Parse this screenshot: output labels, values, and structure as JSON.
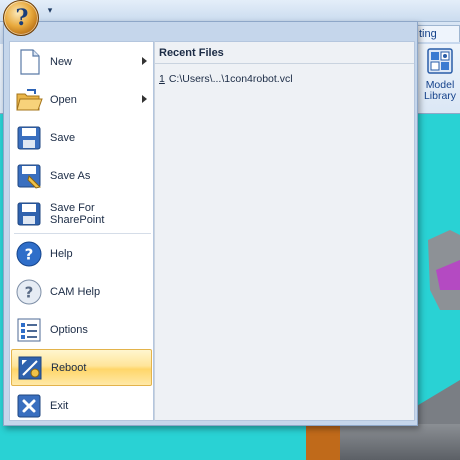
{
  "ribbon": {
    "tab_partial": "ting",
    "model_library": {
      "line1": "Model",
      "line2": "Library"
    }
  },
  "qat": {
    "customize_arrow": "▾"
  },
  "orb": {
    "glyph": "?"
  },
  "menu": {
    "items": [
      {
        "label": "New",
        "icon": "new-document-icon",
        "has_submenu": true
      },
      {
        "label": "Open",
        "icon": "open-folder-icon",
        "has_submenu": true
      },
      {
        "label": "Save",
        "icon": "floppy-disk-icon",
        "has_submenu": false
      },
      {
        "label": "Save As",
        "icon": "save-as-icon",
        "has_submenu": false
      },
      {
        "label": "Save For SharePoint",
        "icon": "sharepoint-save-icon",
        "has_submenu": false
      },
      {
        "label": "Help",
        "icon": "help-icon",
        "has_submenu": false
      },
      {
        "label": "CAM Help",
        "icon": "cam-help-icon",
        "has_submenu": false
      },
      {
        "label": "Options",
        "icon": "options-icon",
        "has_submenu": false
      },
      {
        "label": "Reboot",
        "icon": "reboot-icon",
        "has_submenu": false,
        "highlighted": true
      },
      {
        "label": "Exit",
        "icon": "exit-icon",
        "has_submenu": false
      }
    ],
    "recent": {
      "header": "Recent Files",
      "files": [
        {
          "number": "1",
          "path": "C:\\Users\\...\\1con4robot.vcl"
        }
      ]
    }
  },
  "colors": {
    "viewport": "#29d2d4",
    "highlight": "#ffd66a",
    "ribbon_text": "#15428b"
  }
}
